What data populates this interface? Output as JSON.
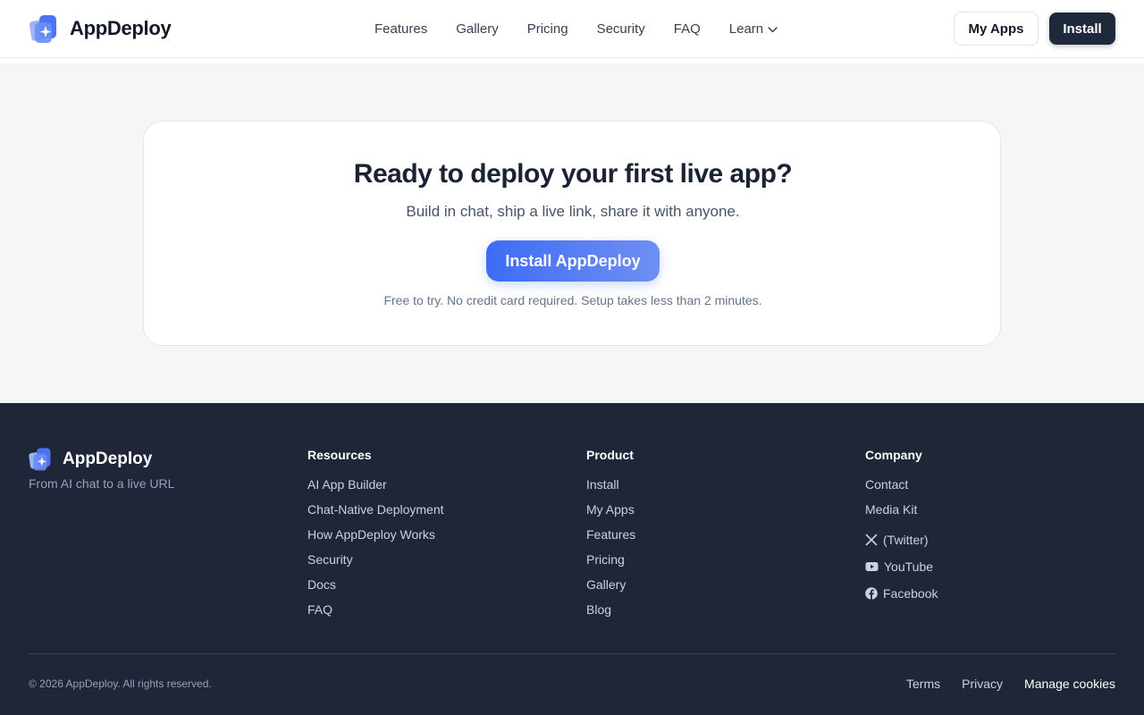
{
  "brand": {
    "name": "AppDeploy",
    "accent": "#3d6cf5",
    "logo_icon": "appdeploy-logo-icon"
  },
  "nav": {
    "items": [
      "Features",
      "Gallery",
      "Pricing",
      "Security",
      "FAQ"
    ],
    "learn_label": "Learn"
  },
  "header": {
    "my_apps_label": "My Apps",
    "install_label": "Install"
  },
  "cta": {
    "title": "Ready to deploy your first live app?",
    "subtitle": "Build in chat, ship a live link, share it with anyone.",
    "button_label": "Install AppDeploy",
    "note": "Free to try. No credit card required. Setup takes less than 2 minutes."
  },
  "footer": {
    "brand_name": "AppDeploy",
    "tagline": "From AI chat to a live URL",
    "resources": {
      "heading": "Resources",
      "links": [
        "AI App Builder",
        "Chat-Native Deployment",
        "How AppDeploy Works",
        "Security",
        "Docs",
        "FAQ"
      ]
    },
    "product": {
      "heading": "Product",
      "links": [
        "Install",
        "My Apps",
        "Features",
        "Pricing",
        "Gallery",
        "Blog"
      ]
    },
    "company": {
      "heading": "Company",
      "links": [
        "Contact",
        "Media Kit"
      ],
      "social": [
        {
          "label": "(Twitter)",
          "icon": "x-icon"
        },
        {
          "label": "YouTube",
          "icon": "youtube-icon"
        },
        {
          "label": "Facebook",
          "icon": "facebook-icon"
        }
      ]
    },
    "copyright": "© 2026 AppDeploy. All rights reserved.",
    "legal": [
      "Terms",
      "Privacy",
      "Manage cookies"
    ]
  }
}
